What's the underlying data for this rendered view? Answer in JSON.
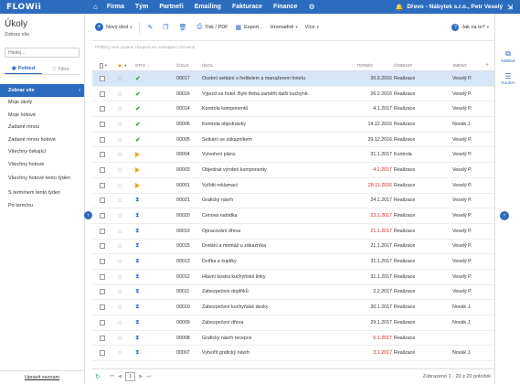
{
  "app": {
    "logo": "FLOWii",
    "nav": [
      "Firma",
      "Tým",
      "Partneři",
      "Emailing",
      "Fakturace",
      "Finance"
    ],
    "company": "Dřevo - Nábytek s.r.o., Petr Veselý",
    "home_icon": "home-icon",
    "gear_icon": "gear-icon"
  },
  "sidebar": {
    "title": "Úkoly",
    "subtitle": "Zobraz vše",
    "search_placeholder": "Hledej...",
    "tab_view": "Pohled",
    "tab_filter": "Filtre",
    "views": [
      {
        "label": "Zobraz vše",
        "active": true
      },
      {
        "label": "Moje úkoly"
      },
      {
        "label": "Moje hotové"
      },
      {
        "label": "Zadané mnou"
      },
      {
        "label": "Zadané mnou hotové"
      },
      {
        "label": "Všechny čekající"
      },
      {
        "label": "Všechny hotové"
      },
      {
        "label": "Všechny hotové tento týden"
      },
      {
        "label": "S termínem tento týden"
      },
      {
        "label": "Po termínu"
      }
    ],
    "edit_list": "Upravit seznam"
  },
  "toolbar": {
    "new_task": "Nový úkol",
    "print": "Tisk / PDF",
    "export": "Export...",
    "bulk": "Hromadně",
    "more": "Více",
    "help": "Jak na to?"
  },
  "filter_hint": "Přefiltruj sem zadané zkoupce pro seskupení záznamů",
  "columns": {
    "status": "STAV",
    "number": "ČÍSLO",
    "task": "ÚKOL",
    "deadline": "TERMÍN",
    "activity": "ČINNOST",
    "name": "JMÉNO"
  },
  "rows": [
    {
      "status": "done",
      "number": "00017",
      "task": "Osobní setkání s ředitelem a manažerem hotelu.",
      "date": "30.9.2016",
      "overdue": false,
      "activity": "Realizace",
      "who": "Veselý P."
    },
    {
      "status": "done",
      "number": "00016",
      "task": "Výjezd na hotel. Bylo třeba zaměřit další kuchyně.",
      "date": "26.2.2016",
      "overdue": false,
      "activity": "Realizace",
      "who": "Veselý P."
    },
    {
      "status": "done",
      "number": "00014",
      "task": "Kontrola komponentů",
      "date": "4.1.2017",
      "overdue": false,
      "activity": "Realizace",
      "who": "Veselý P."
    },
    {
      "status": "done",
      "number": "00006",
      "task": "Kontrola objednávky",
      "date": "14.12.2016",
      "overdue": false,
      "activity": "Realizace",
      "who": "Novák J."
    },
    {
      "status": "done",
      "number": "00005",
      "task": "Setkání se zákazníkem",
      "date": "29.12.2016",
      "overdue": false,
      "activity": "Realizace",
      "who": "Veselý P."
    },
    {
      "status": "progress",
      "number": "00004",
      "task": "Vytvoření plánu",
      "date": "31.1.2017",
      "overdue": false,
      "activity": "Kontrola",
      "who": "Veselý P."
    },
    {
      "status": "progress",
      "number": "00003",
      "task": "Objednat výrobní komponenty",
      "date": "4.1.2017",
      "overdue": true,
      "activity": "Realizace",
      "who": "Veselý P."
    },
    {
      "status": "progress",
      "number": "00001",
      "task": "Vyřídit reklamaci",
      "date": "28.11.2016",
      "overdue": true,
      "activity": "Realizace",
      "who": "Veselý P."
    },
    {
      "status": "waiting",
      "number": "00021",
      "task": "Grafický návrh",
      "date": "24.1.2017",
      "overdue": false,
      "activity": "Realizace",
      "who": "Veselý P."
    },
    {
      "status": "waiting",
      "number": "00020",
      "task": "Cenová nabídka",
      "date": "23.1.2017",
      "overdue": true,
      "activity": "Realizace",
      "who": "Veselý P."
    },
    {
      "status": "waiting",
      "number": "00019",
      "task": "Opracování dřeva",
      "date": "21.1.2017",
      "overdue": true,
      "activity": "Realizace",
      "who": "Veselý P."
    },
    {
      "status": "waiting",
      "number": "00015",
      "task": "Dodání a montáž u zákazníka",
      "date": "21.1.2017",
      "overdue": false,
      "activity": "Realizace",
      "who": "Veselý P."
    },
    {
      "status": "waiting",
      "number": "00013",
      "task": "Dvířka a šuplíky",
      "date": "31.1.2017",
      "overdue": false,
      "activity": "Realizace",
      "who": "Veselý P."
    },
    {
      "status": "waiting",
      "number": "00012",
      "task": "Hlavní kostra kuchyňské linky",
      "date": "31.1.2017",
      "overdue": false,
      "activity": "Realizace",
      "who": "Veselý P."
    },
    {
      "status": "waiting",
      "number": "00011",
      "task": "Zabezpečení doplňků",
      "date": "2.2.2017",
      "overdue": false,
      "activity": "Realizace",
      "who": "Veselý P."
    },
    {
      "status": "waiting",
      "number": "00010",
      "task": "Zabezpečení kuchyňské desky",
      "date": "30.1.2017",
      "overdue": false,
      "activity": "Realizace",
      "who": "Novák J."
    },
    {
      "status": "waiting",
      "number": "00009",
      "task": "Zabezpečení dřeva",
      "date": "29.1.2017",
      "overdue": false,
      "activity": "Realizace",
      "who": "Novák J."
    },
    {
      "status": "waiting",
      "number": "00008",
      "task": "Grafický návrh recepce",
      "date": "5.1.2017",
      "overdue": true,
      "activity": "Realizace",
      "who": ""
    },
    {
      "status": "waiting",
      "number": "00007",
      "task": "Vytvořit grafický návrh",
      "date": "3.1.2017",
      "overdue": true,
      "activity": "Realizace",
      "who": "Novák J."
    }
  ],
  "footer": {
    "page": "1",
    "summary": "Zobrazeno 1 - 20 z 20 položek"
  },
  "right_panel": {
    "preview": "Náhled",
    "summary": "Souhrn"
  },
  "colors": {
    "accent": "#2c6cbf",
    "done": "#3aa349",
    "progress": "#f3a11b",
    "overdue": "#e02020",
    "selected_row": "#d6e6f8"
  }
}
